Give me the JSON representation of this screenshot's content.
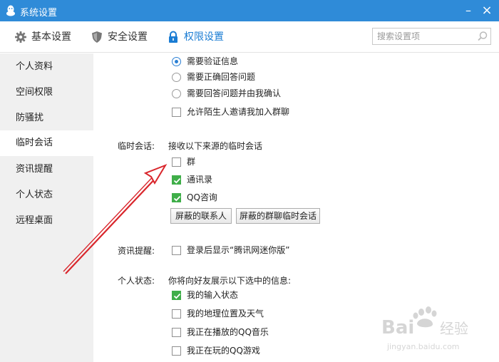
{
  "window": {
    "title": "系统设置",
    "min_glyph": "–",
    "close_glyph": "×"
  },
  "tabs": [
    {
      "label": "基本设置",
      "icon": "gear-icon"
    },
    {
      "label": "安全设置",
      "icon": "shield-icon"
    },
    {
      "label": "权限设置",
      "icon": "lock-icon",
      "active": true
    }
  ],
  "search": {
    "placeholder": "搜索设置项"
  },
  "sidebar": {
    "items": [
      {
        "label": "个人资料"
      },
      {
        "label": "空间权限"
      },
      {
        "label": "防骚扰"
      },
      {
        "label": "临时会话",
        "active": true
      },
      {
        "label": "资讯提醒"
      },
      {
        "label": "个人状态"
      },
      {
        "label": "远程桌面"
      }
    ]
  },
  "verification": {
    "options": [
      {
        "label": "需要验证信息",
        "checked": true
      },
      {
        "label": "需要正确回答问题",
        "checked": false
      },
      {
        "label": "需要回答问题并由我确认",
        "checked": false
      }
    ],
    "allow_stranger_invite": {
      "label": "允许陌生人邀请我加入群聊",
      "checked": false
    }
  },
  "temp_session": {
    "label": "临时会话:",
    "desc": "接收以下来源的临时会话",
    "options": [
      {
        "label": "群",
        "checked": false
      },
      {
        "label": "通讯录",
        "checked": true
      },
      {
        "label": "QQ咨询",
        "checked": true
      }
    ],
    "buttons": {
      "blocked_contacts": "屏蔽的联系人",
      "blocked_group_sessions": "屏蔽的群聊临时会话"
    }
  },
  "news_reminder": {
    "label": "资讯提醒:",
    "option": {
      "label": "登录后显示“腾讯网迷你版”",
      "checked": false
    }
  },
  "personal_status": {
    "label": "个人状态:",
    "desc": "你将向好友展示以下选中的信息:",
    "options": [
      {
        "label": "我的输入状态",
        "checked": true
      },
      {
        "label": "我的地理位置及天气",
        "checked": false
      },
      {
        "label": "我正在播放的QQ音乐",
        "checked": false
      },
      {
        "label": "我正在玩的QQ游戏",
        "checked": false
      }
    ]
  },
  "colors": {
    "titlebar": "#2f8bd8",
    "accent": "#1a7cd3",
    "checked_green": "#3fae49",
    "annotation_arrow": "#d9262c"
  },
  "watermark": {
    "text": "Bai du 经验",
    "subtext": "jingyan.baidu.com"
  }
}
